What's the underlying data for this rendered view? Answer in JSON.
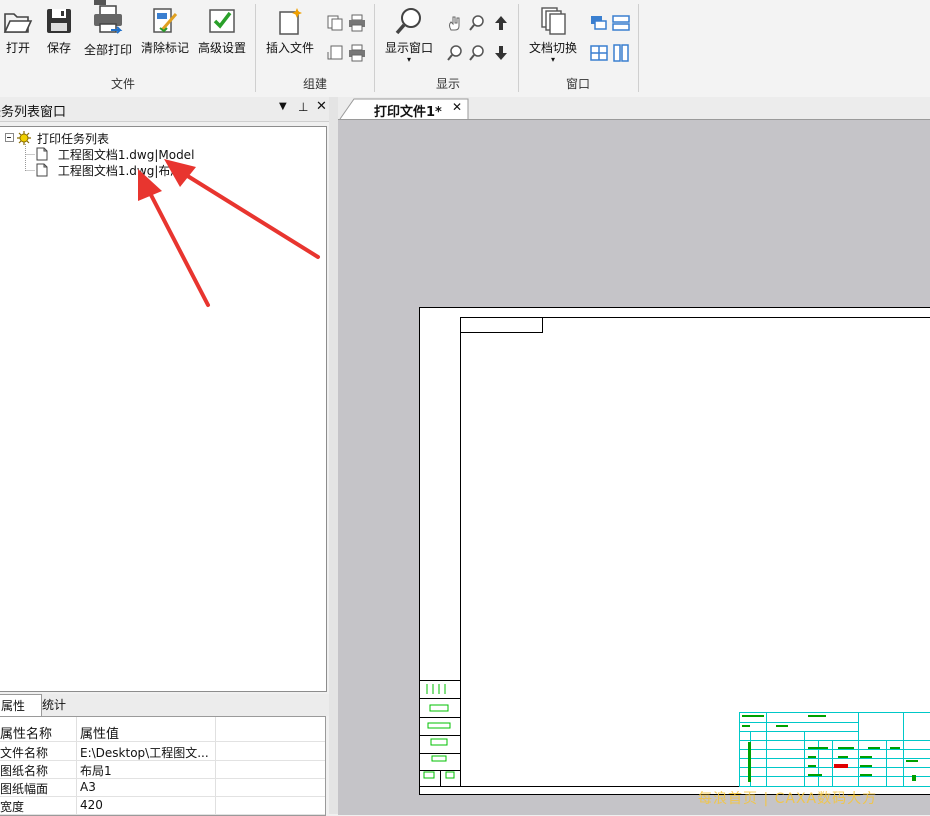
{
  "ribbon": {
    "file_group": {
      "label": "文件",
      "buttons": [
        {
          "label": "打开",
          "icon": "folder-open-icon"
        },
        {
          "label": "保存",
          "icon": "save-icon"
        },
        {
          "label": "全部打印",
          "icon": "printer-icon"
        },
        {
          "label": "清除标记",
          "icon": "clear-mark-icon"
        },
        {
          "label": "高级设置",
          "icon": "settings-check-icon"
        }
      ]
    },
    "build_group": {
      "label": "组建",
      "buttons": [
        {
          "label": "插入文件",
          "icon": "insert-file-icon"
        }
      ]
    },
    "display_group": {
      "label": "显示",
      "buttons": [
        {
          "label": "显示窗口",
          "icon": "magnifier-icon"
        }
      ]
    },
    "window_group": {
      "label": "窗口",
      "buttons": [
        {
          "label": "文档切换",
          "icon": "documents-icon"
        }
      ]
    }
  },
  "task_panel": {
    "title": "任务列表窗口",
    "tree": {
      "root": "打印任务列表",
      "items": [
        {
          "label": "工程图文档1.dwg|Model"
        },
        {
          "label": "工程图文档1.dwg|布局"
        }
      ]
    }
  },
  "properties": {
    "tabs": [
      "属性",
      "统计"
    ],
    "header": {
      "name": "属性名称",
      "value": "属性值"
    },
    "rows": [
      {
        "name": "文件名称",
        "value": "E:\\Desktop\\工程图文..."
      },
      {
        "name": "图纸名称",
        "value": "布局1"
      },
      {
        "name": "图纸幅面",
        "value": "A3"
      },
      {
        "name": "宽度",
        "value": "420"
      }
    ]
  },
  "document": {
    "tab_label": "打印文件1*"
  },
  "watermark": "每浪首页 | CAXA数码大方",
  "colors": {
    "accent_red": "#e8352f",
    "drawing_green": "#00c000",
    "drawing_cyan": "#00c8c8"
  }
}
